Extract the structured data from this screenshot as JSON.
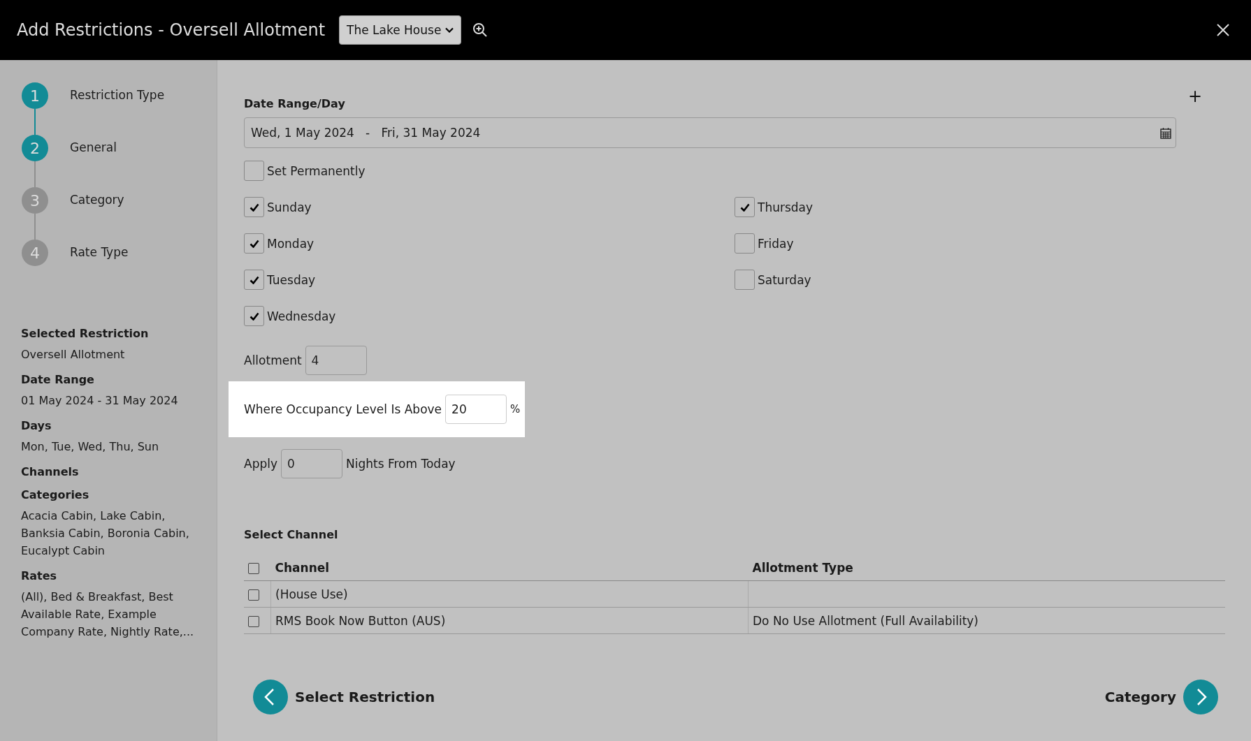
{
  "window": {
    "title": "Add Restrictions - Oversell Allotment",
    "property_select": {
      "value": "The Lake House"
    }
  },
  "steps": [
    {
      "number": "1",
      "label": "Restriction Type",
      "completed": true
    },
    {
      "number": "2",
      "label": "General",
      "completed": true
    },
    {
      "number": "3",
      "label": "Category",
      "completed": false
    },
    {
      "number": "4",
      "label": "Rate Type",
      "completed": false
    }
  ],
  "summary": [
    {
      "heading": "Selected Restriction",
      "value": "Oversell Allotment"
    },
    {
      "heading": "Date Range",
      "value": "01 May 2024 - 31 May 2024"
    },
    {
      "heading": "Days",
      "value": "Mon, Tue, Wed, Thu, Sun"
    },
    {
      "heading": "Channels"
    },
    {
      "heading": "Categories",
      "value": "Acacia Cabin, Lake Cabin, Banksia Cabin, Boronia Cabin, Eucalypt Cabin"
    },
    {
      "heading": "Rates",
      "value": "(All), Bed & Breakfast, Best Available Rate, Example Company Rate, Nightly Rate,..."
    }
  ],
  "date_section": {
    "heading": "Date Range/Day",
    "add_label": "+",
    "date_range": {
      "value": "Wed, 1 May 2024   -   Fri, 31 May 2024"
    },
    "set_permanently": {
      "label": "Set Permanently",
      "checked": false
    }
  },
  "days_left": [
    {
      "label": "Sunday",
      "checked": true
    },
    {
      "label": "Monday",
      "checked": true
    },
    {
      "label": "Tuesday",
      "checked": true
    },
    {
      "label": "Wednesday",
      "checked": true
    }
  ],
  "days_right": [
    {
      "label": "Thursday",
      "checked": true
    },
    {
      "label": "Friday",
      "checked": false
    },
    {
      "label": "Saturday",
      "checked": false
    }
  ],
  "allotment": {
    "label": "Allotment",
    "value": "4"
  },
  "occupancy": {
    "label": "Where Occupancy Level Is Above",
    "value": "20",
    "unit": "%"
  },
  "apply": {
    "label": "Apply",
    "value": "0",
    "suffix": "Nights From Today"
  },
  "channels": {
    "heading": "Select Channel",
    "select_all": false,
    "columns": [
      "Channel",
      "Allotment Type"
    ],
    "rows": [
      {
        "channel": "(House Use)",
        "checked": false
      },
      {
        "channel": "RMS Book Now Button (AUS)",
        "allotment_type": "Do No Use Allotment (Full Availability)",
        "checked": false
      }
    ]
  },
  "footer": {
    "back_label": "Select Restriction",
    "next_label": "Category"
  }
}
